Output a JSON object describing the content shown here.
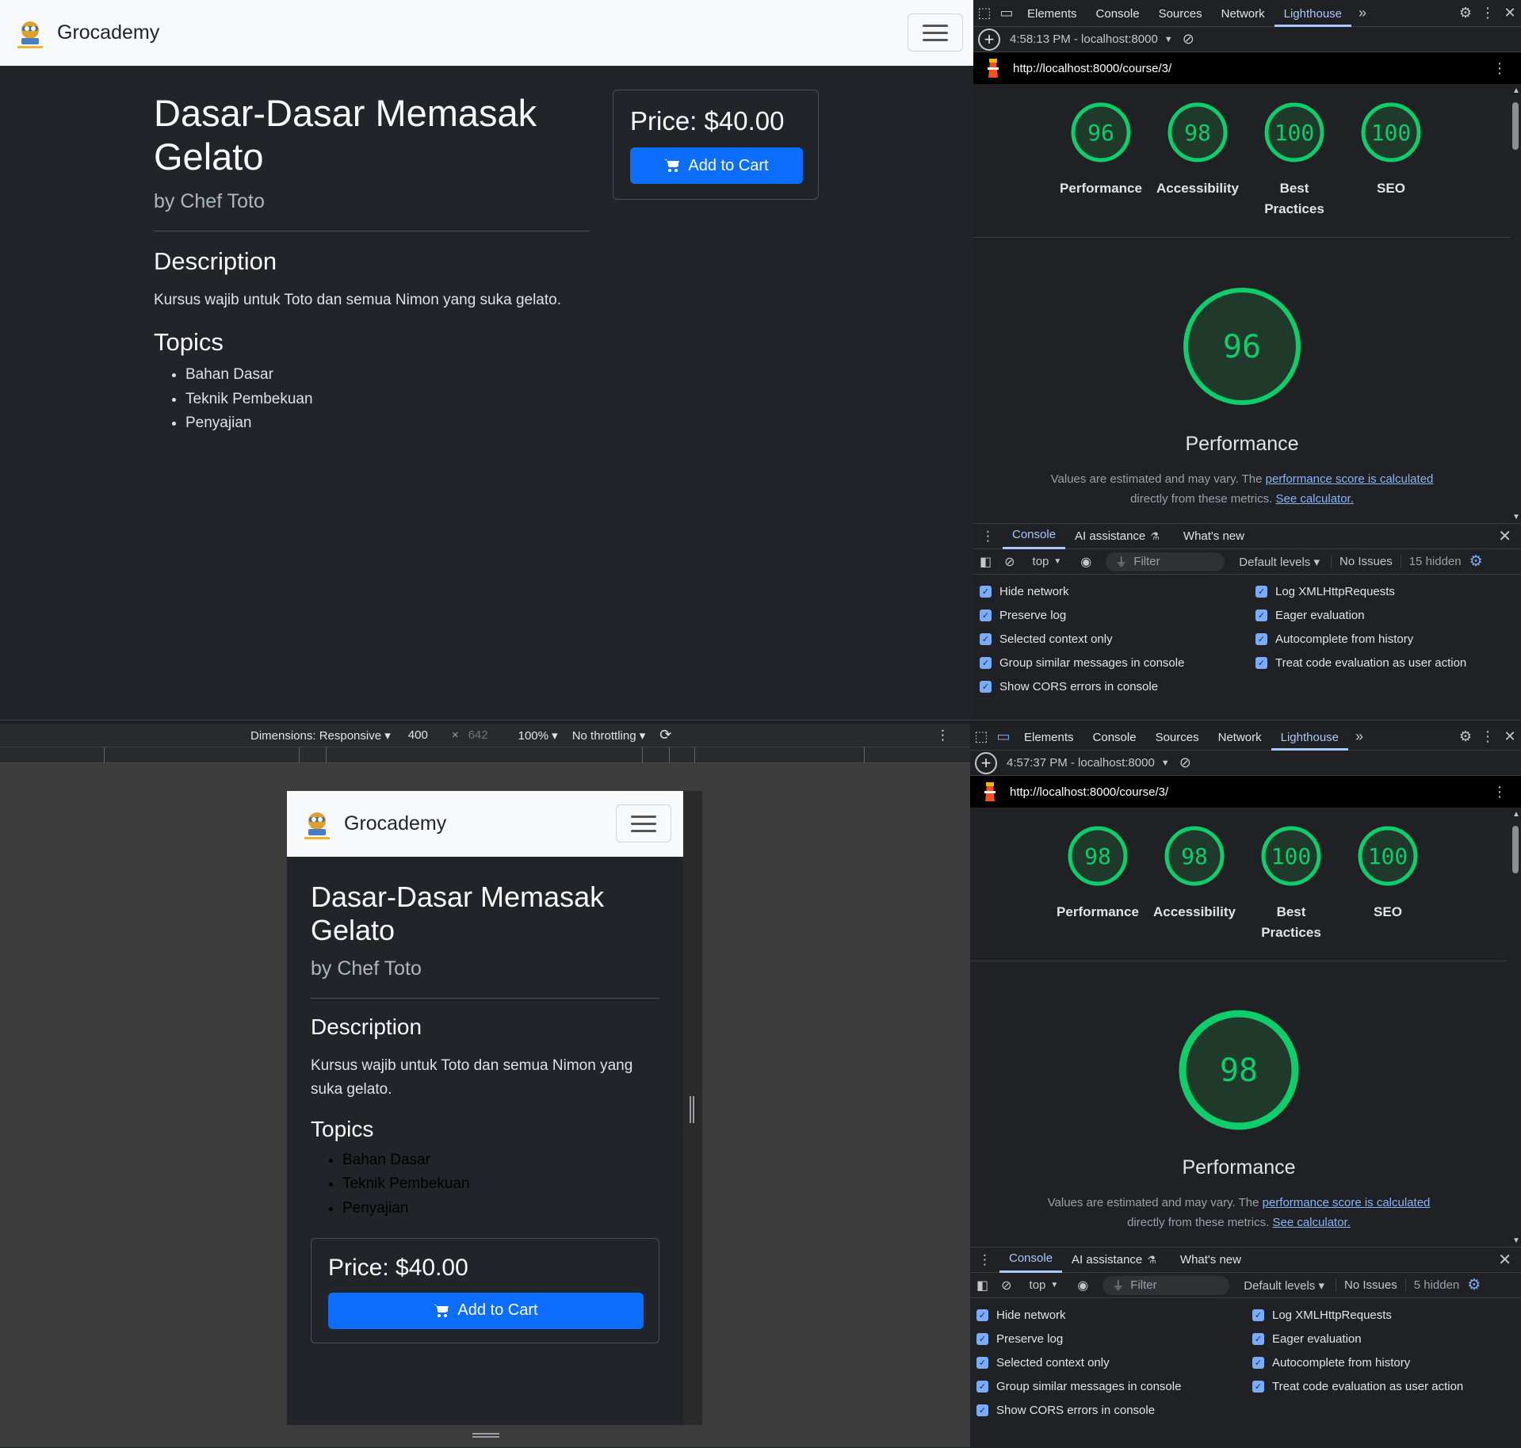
{
  "top": {
    "site": {
      "brand": "Grocademy",
      "course_title": "Dasar-Dasar Memasak Gelato",
      "author": "by Chef Toto",
      "description_heading": "Description",
      "description": "Kursus wajib untuk Toto dan semua Nimon yang suka gelato.",
      "topics_heading": "Topics",
      "topics": [
        "Bahan Dasar",
        "Teknik Pembekuan",
        "Penyajian"
      ],
      "price": "Price: $40.00",
      "add_to_cart": "Add to Cart"
    },
    "devtools": {
      "tabs": [
        "Elements",
        "Console",
        "Sources",
        "Network",
        "Lighthouse"
      ],
      "active_tab": "Lighthouse",
      "report_time": "4:58:13 PM - localhost:8000",
      "url": "http://localhost:8000/course/3/",
      "scores": [
        {
          "value": 96,
          "label": "Performance"
        },
        {
          "value": 98,
          "label": "Accessibility"
        },
        {
          "value": 100,
          "label": "Best Practices"
        },
        {
          "value": 100,
          "label": "SEO"
        }
      ],
      "big_score": {
        "value": 96,
        "label": "Performance"
      },
      "note_prefix": "Values are estimated and may vary. The",
      "note_link1": "performance score is calculated",
      "note_mid": "directly from these metrics.",
      "note_link2": "See calculator.",
      "drawer_tabs": [
        "Console",
        "AI assistance",
        "What's new"
      ],
      "context": "top",
      "filter_placeholder": "Filter",
      "levels": "Default levels",
      "issues": "No Issues",
      "hidden": "15 hidden",
      "settings_left": [
        "Hide network",
        "Preserve log",
        "Selected context only",
        "Group similar messages in console",
        "Show CORS errors in console"
      ],
      "settings_right": [
        "Log XMLHttpRequests",
        "Eager evaluation",
        "Autocomplete from history",
        "Treat code evaluation as user action"
      ]
    }
  },
  "bottom": {
    "emulation": {
      "dimensions": "Dimensions: Responsive",
      "width": "400",
      "times": "×",
      "height": "642",
      "zoom": "100%",
      "throttling": "No throttling"
    },
    "devtools": {
      "report_time": "4:57:37 PM - localhost:8000",
      "url": "http://localhost:8000/course/3/",
      "scores": [
        {
          "value": 98,
          "label": "Performance"
        },
        {
          "value": 98,
          "label": "Accessibility"
        },
        {
          "value": 100,
          "label": "Best Practices"
        },
        {
          "value": 100,
          "label": "SEO"
        }
      ],
      "big_score": {
        "value": 98,
        "label": "Performance"
      },
      "hidden": "5 hidden"
    }
  },
  "colors": {
    "pass": "#0cce6b",
    "primary": "#0d6efd",
    "accent": "#a8c7fa"
  }
}
